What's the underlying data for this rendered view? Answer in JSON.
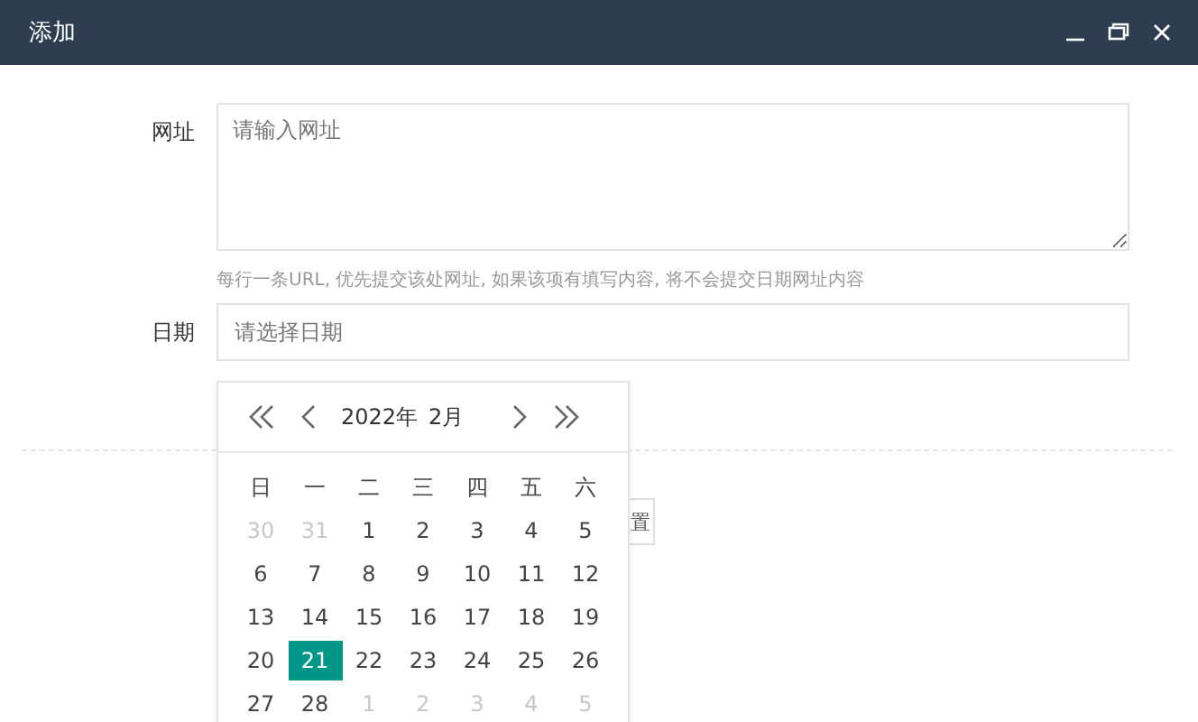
{
  "window": {
    "title": "添加"
  },
  "form": {
    "url_label": "网址",
    "url_placeholder": "请输入网址",
    "url_hint": "每行一条URL, 优先提交该处网址, 如果该项有填写内容, 将不会提交日期网址内容",
    "date_label": "日期",
    "date_placeholder": "请选择日期",
    "button_fragment": "置"
  },
  "calendar": {
    "year": "2022年",
    "month": "2月",
    "weekdays": [
      "日",
      "一",
      "二",
      "三",
      "四",
      "五",
      "六"
    ],
    "weeks": [
      [
        {
          "day": "30",
          "other_month": true,
          "selected": false
        },
        {
          "day": "31",
          "other_month": true,
          "selected": false
        },
        {
          "day": "1",
          "other_month": false,
          "selected": false
        },
        {
          "day": "2",
          "other_month": false,
          "selected": false
        },
        {
          "day": "3",
          "other_month": false,
          "selected": false
        },
        {
          "day": "4",
          "other_month": false,
          "selected": false
        },
        {
          "day": "5",
          "other_month": false,
          "selected": false
        }
      ],
      [
        {
          "day": "6",
          "other_month": false,
          "selected": false
        },
        {
          "day": "7",
          "other_month": false,
          "selected": false
        },
        {
          "day": "8",
          "other_month": false,
          "selected": false
        },
        {
          "day": "9",
          "other_month": false,
          "selected": false
        },
        {
          "day": "10",
          "other_month": false,
          "selected": false
        },
        {
          "day": "11",
          "other_month": false,
          "selected": false
        },
        {
          "day": "12",
          "other_month": false,
          "selected": false
        }
      ],
      [
        {
          "day": "13",
          "other_month": false,
          "selected": false
        },
        {
          "day": "14",
          "other_month": false,
          "selected": false
        },
        {
          "day": "15",
          "other_month": false,
          "selected": false
        },
        {
          "day": "16",
          "other_month": false,
          "selected": false
        },
        {
          "day": "17",
          "other_month": false,
          "selected": false
        },
        {
          "day": "18",
          "other_month": false,
          "selected": false
        },
        {
          "day": "19",
          "other_month": false,
          "selected": false
        }
      ],
      [
        {
          "day": "20",
          "other_month": false,
          "selected": false
        },
        {
          "day": "21",
          "other_month": false,
          "selected": true
        },
        {
          "day": "22",
          "other_month": false,
          "selected": false
        },
        {
          "day": "23",
          "other_month": false,
          "selected": false
        },
        {
          "day": "24",
          "other_month": false,
          "selected": false
        },
        {
          "day": "25",
          "other_month": false,
          "selected": false
        },
        {
          "day": "26",
          "other_month": false,
          "selected": false
        }
      ],
      [
        {
          "day": "27",
          "other_month": false,
          "selected": false
        },
        {
          "day": "28",
          "other_month": false,
          "selected": false
        },
        {
          "day": "1",
          "other_month": true,
          "selected": false
        },
        {
          "day": "2",
          "other_month": true,
          "selected": false
        },
        {
          "day": "3",
          "other_month": true,
          "selected": false
        },
        {
          "day": "4",
          "other_month": true,
          "selected": false
        },
        {
          "day": "5",
          "other_month": true,
          "selected": false
        }
      ]
    ]
  }
}
